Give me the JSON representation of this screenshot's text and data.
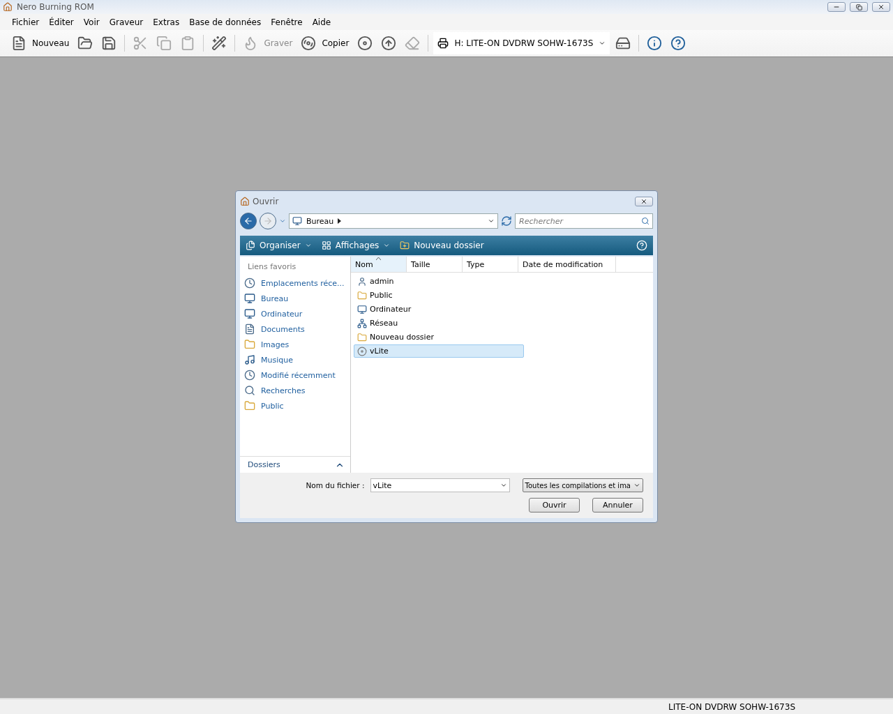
{
  "window": {
    "title": "Nero Burning ROM"
  },
  "menu": [
    "Fichier",
    "Éditer",
    "Voir",
    "Graveur",
    "Extras",
    "Base de données",
    "Fenêtre",
    "Aide"
  ],
  "toolbar": [
    {
      "kind": "button",
      "label": "Nouveau",
      "disabled": false
    },
    {
      "kind": "button",
      "disabled": false
    },
    {
      "kind": "button",
      "disabled": false
    },
    {
      "kind": "separator"
    },
    {
      "kind": "button",
      "disabled": true
    },
    {
      "kind": "button",
      "disabled": true
    },
    {
      "kind": "button",
      "disabled": true
    },
    {
      "kind": "separator"
    },
    {
      "kind": "button",
      "disabled": false
    },
    {
      "kind": "separator"
    },
    {
      "kind": "button",
      "label": "Graver",
      "disabled": true
    },
    {
      "kind": "button",
      "label": "Copier",
      "disabled": false
    },
    {
      "kind": "button",
      "disabled": false
    },
    {
      "kind": "button",
      "disabled": false
    },
    {
      "kind": "button",
      "disabled": true
    },
    {
      "kind": "separator"
    },
    {
      "kind": "drive",
      "label": "H: LITE-ON DVDRW SOHW-1673S"
    },
    {
      "kind": "button",
      "disabled": false
    },
    {
      "kind": "separator"
    },
    {
      "kind": "button",
      "disabled": false
    },
    {
      "kind": "button",
      "disabled": false
    }
  ],
  "dialog": {
    "title": "Ouvrir",
    "location": "Bureau",
    "search": {
      "placeholder": "Rechercher"
    },
    "commands": [
      "Organiser",
      "Affichages",
      "Nouveau dossier"
    ],
    "favorites_title": "Liens favoris",
    "favorites": [
      "Emplacements réce...",
      "Bureau",
      "Ordinateur",
      "Documents",
      "Images",
      "Musique",
      "Modifié récemment",
      "Recherches",
      "Public"
    ],
    "folders_label": "Dossiers",
    "columns": [
      {
        "label": "Nom",
        "sorted": true
      },
      {
        "label": "Taille",
        "sorted": false
      },
      {
        "label": "Type",
        "sorted": false
      },
      {
        "label": "Date de modification",
        "sorted": false
      }
    ],
    "files": [
      {
        "name": "admin",
        "selected": false
      },
      {
        "name": "Public",
        "selected": false
      },
      {
        "name": "Ordinateur",
        "selected": false
      },
      {
        "name": "Réseau",
        "selected": false
      },
      {
        "name": "Nouveau dossier",
        "selected": false
      },
      {
        "name": "vLite",
        "selected": true
      }
    ],
    "filename_label": "Nom du fichier :",
    "filename": "vLite",
    "filter": "Toutes les compilations et ima",
    "buttons": [
      "Ouvrir",
      "Annuler"
    ]
  },
  "status_bar": "LITE-ON  DVDRW SOHW-1673S"
}
